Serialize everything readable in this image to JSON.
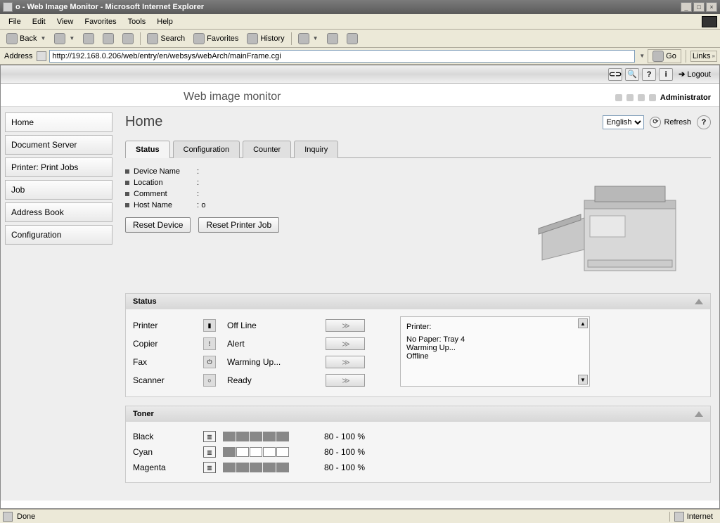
{
  "window": {
    "title": "o - Web Image Monitor - Microsoft Internet Explorer"
  },
  "menu": {
    "file": "File",
    "edit": "Edit",
    "view": "View",
    "favorites": "Favorites",
    "tools": "Tools",
    "help": "Help"
  },
  "toolbar": {
    "back": "Back",
    "search": "Search",
    "favorites": "Favorites",
    "history": "History"
  },
  "addressbar": {
    "label": "Address",
    "url": "http://192.168.0.206/web/entry/en/websys/webArch/mainFrame.cgi",
    "go": "Go",
    "links": "Links"
  },
  "topbar": {
    "logout": "Logout"
  },
  "banner": {
    "title": "Web image monitor",
    "user": "Administrator"
  },
  "sidebar": {
    "items": [
      {
        "label": "Home"
      },
      {
        "label": "Document Server"
      },
      {
        "label": "Printer: Print Jobs"
      },
      {
        "label": "Job"
      },
      {
        "label": "Address Book"
      },
      {
        "label": "Configuration"
      }
    ]
  },
  "page_title": "Home",
  "language": "English",
  "refresh": "Refresh",
  "tabs": [
    {
      "label": "Status",
      "active": true
    },
    {
      "label": "Configuration"
    },
    {
      "label": "Counter"
    },
    {
      "label": "Inquiry"
    }
  ],
  "device": {
    "fields": [
      {
        "key": "Device Name",
        "sep": ":",
        "value": ""
      },
      {
        "key": "Location",
        "sep": ":",
        "value": ""
      },
      {
        "key": "Comment",
        "sep": ":",
        "value": ""
      },
      {
        "key": "Host Name",
        "sep": ":",
        "value": "o"
      }
    ],
    "reset_device": "Reset Device",
    "reset_printer": "Reset Printer Job"
  },
  "status": {
    "heading": "Status",
    "items": [
      {
        "label": "Printer",
        "state": "Off Line"
      },
      {
        "label": "Copier",
        "state": "Alert"
      },
      {
        "label": "Fax",
        "state": "Warming Up..."
      },
      {
        "label": "Scanner",
        "state": "Ready"
      }
    ],
    "messages_title": "Printer:",
    "messages": [
      "No Paper: Tray 4",
      "Warming Up...",
      "Offline"
    ]
  },
  "toner": {
    "heading": "Toner",
    "items": [
      {
        "label": "Black",
        "value": "80 - 100 %",
        "fill": 5
      },
      {
        "label": "Cyan",
        "value": "80 - 100 %",
        "fill": 1
      },
      {
        "label": "Magenta",
        "value": "80 - 100 %",
        "fill": 5
      }
    ]
  },
  "statusbar": {
    "done": "Done",
    "zone": "Internet"
  }
}
